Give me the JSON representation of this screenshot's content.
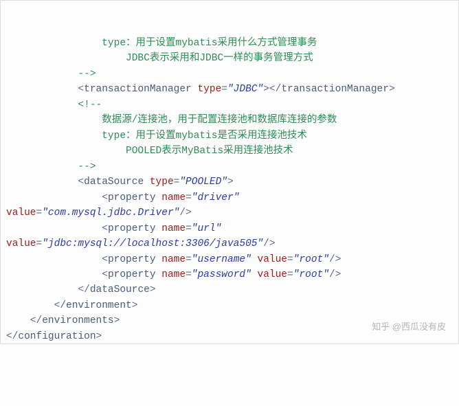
{
  "lines": {
    "l1": "                type：用于设置mybatis采用什么方式管理事务",
    "l2": "                    JDBC表示采用和JDBC一样的事务管理方式",
    "l3": "            -->",
    "l4a": "            <",
    "l4b": "transactionManager",
    "l4c": " type",
    "l4d": "=",
    "l4e": "\"JDBC\"",
    "l4f": "></",
    "l4g": "transactionManager",
    "l4h": ">",
    "l5": "            <!--",
    "l6": "                数据源/连接池，用于配置连接池和数据库连接的参数",
    "l7": "                type：用于设置mybatis是否采用连接池技术",
    "l8": "                    POOLED表示MyBatis采用连接池技术",
    "l9": "            -->",
    "l10a": "            <",
    "l10b": "dataSource",
    "l10c": " type",
    "l10d": "=",
    "l10e": "\"POOLED\"",
    "l10f": ">",
    "l11a": "                <",
    "l11b": "property",
    "l11c": " name",
    "l11d": "=",
    "l11e": "\"driver\"",
    "l12a": "value",
    "l12b": "=",
    "l12c": "\"com.mysql.jdbc.Driver\"",
    "l12d": "/>",
    "l13a": "                <",
    "l13b": "property",
    "l13c": " name",
    "l13d": "=",
    "l13e": "\"url\"",
    "l14a": "value",
    "l14b": "=",
    "l14c": "\"jdbc:mysql://localhost:3306/java505\"",
    "l14d": "/>",
    "l15a": "                <",
    "l15b": "property",
    "l15c": " name",
    "l15d": "=",
    "l15e": "\"username\"",
    "l15f": " value",
    "l15g": "=",
    "l15h": "\"root\"",
    "l15i": "/>",
    "l16a": "                <",
    "l16b": "property",
    "l16c": " name",
    "l16d": "=",
    "l16e": "\"password\"",
    "l16f": " value",
    "l16g": "=",
    "l16h": "\"root\"",
    "l16i": "/>",
    "l17a": "            </",
    "l17b": "dataSource",
    "l17c": ">",
    "l18a": "        </",
    "l18b": "environment",
    "l18c": ">",
    "l19a": "    </",
    "l19b": "environments",
    "l19c": ">",
    "l20a": "</",
    "l20b": "configuration",
    "l20c": ">"
  },
  "watermark": "知乎 @西瓜没有皮"
}
